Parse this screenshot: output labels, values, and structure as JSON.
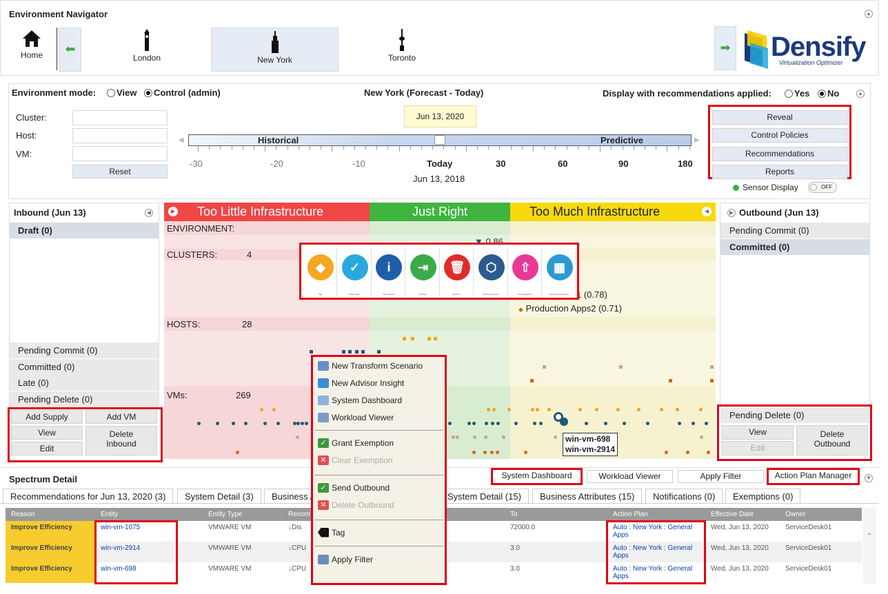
{
  "header": {
    "title": "Environment Navigator",
    "home": "Home",
    "locations": [
      "London",
      "New York",
      "Toronto"
    ],
    "logo_main": "Densify",
    "logo_sub": "Virtualization Optimizer"
  },
  "mode": {
    "label": "Environment mode:",
    "view": "View",
    "control": "Control (admin)",
    "center": "New York (Forecast - Today)",
    "display_label": "Display with recommendations applied:",
    "yes": "Yes",
    "no": "No"
  },
  "filters": {
    "cluster": "Cluster:",
    "host": "Host:",
    "vm": "VM:",
    "reset": "Reset"
  },
  "timeline": {
    "tooltip": "Jun 13, 2020",
    "historical": "Historical",
    "predictive": "Predictive",
    "ticks": [
      "-30",
      "-20",
      "-10",
      "Today",
      "30",
      "60",
      "90",
      "180"
    ],
    "date": "Jun 13, 2018"
  },
  "right_buttons": {
    "reveal": "Reveal",
    "control": "Control Policies",
    "recommendations": "Recommendations",
    "reports": "Reports",
    "sensor": "Sensor Display",
    "toggle": "OFF"
  },
  "inbound": {
    "title": "Inbound (Jun 13)",
    "draft": "Draft (0)",
    "pending_commit": "Pending Commit (0)",
    "committed": "Committed (0)",
    "late": "Late (0)",
    "pending_delete": "Pending Delete (0)",
    "add_supply": "Add Supply",
    "add_vm": "Add VM",
    "view": "View",
    "edit": "Edit",
    "delete": "Delete Inbound"
  },
  "spectrum": {
    "too_little": "Too Little Infrastructure",
    "just_right": "Just Right",
    "too_much": "Too Much Infrastructure",
    "environment": "ENVIRONMENT:",
    "env_value": "0.86",
    "clusters": "CLUSTERS:",
    "clusters_n": "4",
    "hosts": "HOSTS:",
    "hosts_n": "28",
    "vms": "VMs:",
    "vms_n": "269",
    "label1": "1 (0.78)",
    "label2": "Production Apps2 (0.71)",
    "label0": ")",
    "vm_tag1": "win-vm-698",
    "vm_tag2": "win-vm-2914"
  },
  "icon_bar": [
    {
      "name": "tag",
      "label": "Tag",
      "color": "#f5a623"
    },
    {
      "name": "action-plans",
      "label": "Action Plans",
      "color": "#29a8e0"
    },
    {
      "name": "show-detail",
      "label": "Show Detail",
      "color": "#1f5fa8"
    },
    {
      "name": "transfer",
      "label": "Transfer",
      "color": "#3daa4a"
    },
    {
      "name": "remove",
      "label": "Remove",
      "color": "#e02b2b"
    },
    {
      "name": "refresh-services",
      "label": "Refresh Services",
      "color": "#2c5b8f"
    },
    {
      "name": "cloud-migration",
      "label": "Cloud Migration",
      "color": "#e83a95"
    },
    {
      "name": "assessment",
      "label": "Sending Assessment",
      "color": "#2b9ad3"
    }
  ],
  "outbound": {
    "title": "Outbound (Jun 13)",
    "pending_commit": "Pending Commit (0)",
    "committed": "Committed (0)",
    "pending_delete": "Pending Delete (0)",
    "view": "View",
    "edit": "Edit",
    "delete": "Delete Outbound"
  },
  "context_menu": {
    "items": [
      "New Transform Scenario",
      "New Advisor Insight",
      "System Dashboard",
      "Workload Viewer",
      "Grant Exemption",
      "Clear Exemption",
      "Send Outbound",
      "Delete Outbound",
      "Tag",
      "Apply Filter"
    ]
  },
  "detail": {
    "title": "Spectrum Detail",
    "buttons": [
      "System Dashboard",
      "Workload Viewer",
      "Apply Filter",
      "Action Plan Manager"
    ],
    "tabs": [
      "Recommendations for Jun 13, 2020 (3)",
      "System Detail (3)",
      "Business A",
      "System Detail (15)",
      "Business Attributes (15)",
      "Notifications (0)",
      "Exemptions (0)"
    ],
    "columns": [
      "Reason",
      "Entity",
      "Entity Type",
      "Recom",
      "To",
      "Action Plan",
      "Effective Date",
      "Owner"
    ],
    "rows": [
      {
        "reason": "Improve Efficiency",
        "entity": "win-vm-1075",
        "type": "VMWARE VM",
        "rec": "Dis",
        "to": "72000.0",
        "plan1": "Auto : New York : General",
        "plan2": "Apps",
        "date": "Wed, Jun 13, 2020",
        "owner": "ServiceDesk01"
      },
      {
        "reason": "Improve Efficiency",
        "entity": "win-vm-2914",
        "type": "VMWARE VM",
        "rec": "CPU",
        "to": "3.0",
        "plan1": "Auto : New York : General",
        "plan2": "Apps",
        "date": "Wed, Jun 13, 2020",
        "owner": "ServiceDesk01"
      },
      {
        "reason": "Improve Efficiency",
        "entity": "win-vm-698",
        "type": "VMWARE VM",
        "rec": "CPU",
        "to": "3.0",
        "plan1": "Auto : New York : General",
        "plan2": "Apps",
        "date": "Wed, Jun 13, 2020",
        "owner": "ServiceDesk01"
      }
    ]
  }
}
